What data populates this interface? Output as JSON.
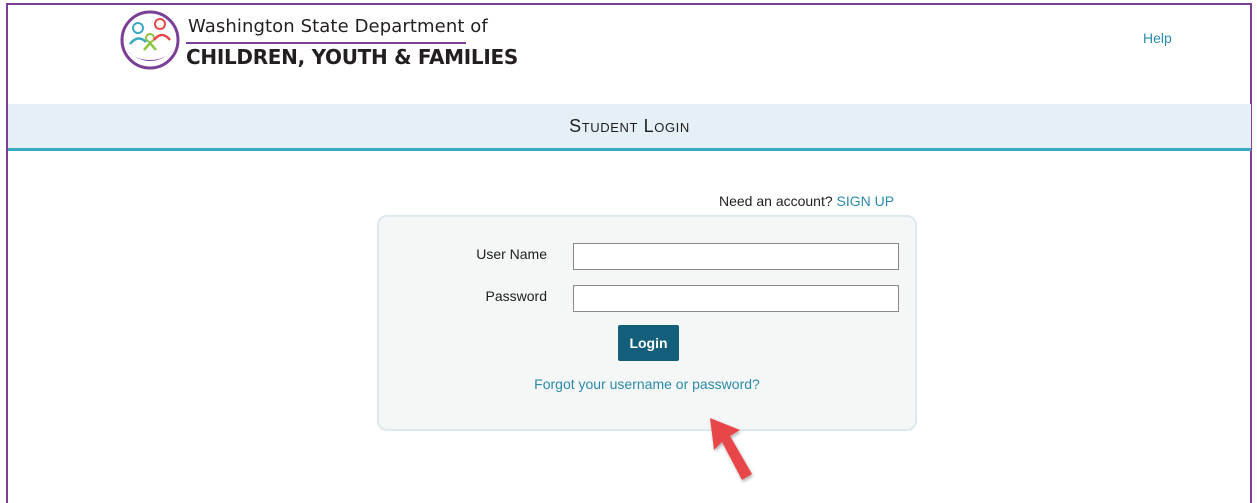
{
  "header": {
    "logo_line1": "Washington State Department of",
    "logo_line2": "CHILDREN, YOUTH & FAMILIES",
    "logo_icon": "dcyf-family-logo-icon",
    "help_label": "Help"
  },
  "title_band": {
    "title": "Student Login"
  },
  "signup": {
    "prompt": "Need an account?",
    "link_label": "SIGN UP"
  },
  "login_form": {
    "username_label": "User Name",
    "username_value": "",
    "password_label": "Password",
    "password_value": "",
    "login_button_label": "Login",
    "forgot_link_label": "Forgot your username or password?"
  },
  "annotation": {
    "arrow_icon": "red-pointer-arrow-icon",
    "arrow_color": "#e8474a"
  },
  "colors": {
    "frame_border": "#7b3f98",
    "link": "#2a8bab",
    "title_band_bg": "#e4f0f6",
    "title_band_rule": "#3aaac3",
    "login_button_bg": "#135e7a"
  }
}
